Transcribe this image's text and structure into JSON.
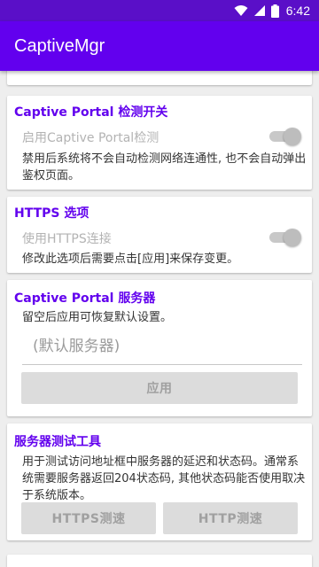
{
  "status_bar": {
    "time": "6:42"
  },
  "app": {
    "title": "CaptiveMgr"
  },
  "portal_switch": {
    "title": "Captive Portal 检测开关",
    "toggle_label": "启用Captive Portal检测",
    "enabled": true,
    "description": "禁用后系统将不会自动检测网络连通性, 也不会自动弹出鉴权页面。"
  },
  "https_options": {
    "title": "HTTPS 选项",
    "toggle_label": "使用HTTPS连接",
    "enabled": true,
    "description": "修改此选项后需要点击[应用]来保存变更。"
  },
  "portal_server": {
    "title": "Captive Portal 服务器",
    "hint": "留空后应用可恢复默认设置。",
    "input_value": "",
    "input_placeholder": "(默认服务器)",
    "apply_label": "应用"
  },
  "server_test": {
    "title": "服务器测试工具",
    "description": "用于测试访问地址框中服务器的延迟和状态码。通常系统需要服务器返回204状态码, 其他状态码能否使用取决于系统版本。",
    "https_button": "HTTPS测速",
    "http_button": "HTTP测速"
  },
  "colors": {
    "primary": "#6200ee",
    "primary_dark": "#5a0fc8"
  }
}
